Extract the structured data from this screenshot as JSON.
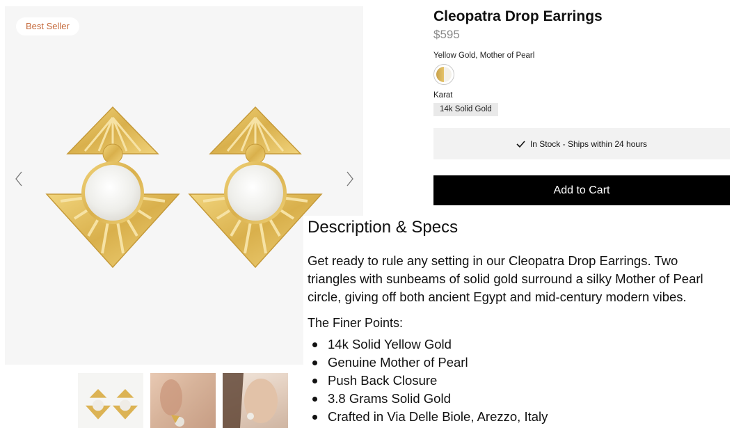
{
  "gallery": {
    "badge": "Best Seller",
    "prev_icon": "chevron-left-icon",
    "next_icon": "chevron-right-icon",
    "thumbnails": [
      "earrings-product-thumbnail",
      "ear-closeup-thumbnail",
      "model-wearing-thumbnail"
    ]
  },
  "product": {
    "title": "Cleopatra Drop Earrings",
    "price": "$595",
    "color_option": "Yellow Gold, Mother of Pearl",
    "karat_label": "Karat",
    "karat_value": "14k Solid Gold",
    "stock_text": "In Stock - Ships within 24 hours",
    "add_to_cart": "Add to Cart"
  },
  "description": {
    "heading": "Description & Specs",
    "body_lines": [
      "Get ready to rule any setting in our Cleopatra Drop Earrings. Two",
      "triangles with sunbeams of solid gold surround a silky Mother of Pearl",
      "circle, giving off both ancient Egypt and mid-century modern vibes."
    ],
    "finer_heading": "The Finer Points:",
    "points": [
      "14k Solid Yellow Gold",
      "Genuine Mother of Pearl",
      "Push Back Closure",
      "3.8 Grams Solid Gold",
      "Crafted in Via Delle Biole, Arezzo, Italy"
    ]
  },
  "colors": {
    "badge_text": "#c4683a",
    "price": "#8a8a8a",
    "gold": "#e1bb55",
    "button": "#000000"
  }
}
